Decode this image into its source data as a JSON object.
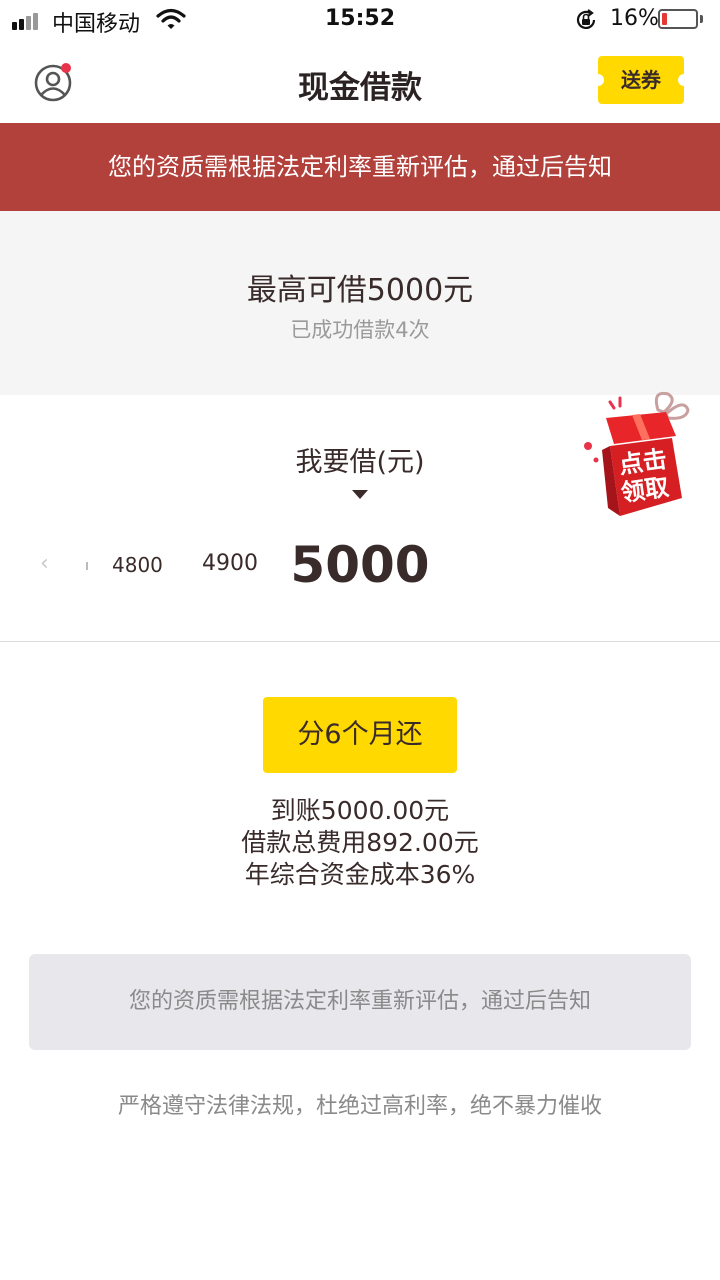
{
  "status_bar": {
    "carrier": "中国移动",
    "time": "15:52",
    "battery_percent": "16%",
    "battery_level": 0.16,
    "battery_color": "#e53935"
  },
  "nav": {
    "title": "现金借款",
    "coupon_label": "送券",
    "coupon_color": "#ffd900",
    "user_icon": "user-profile-icon",
    "notification_dot_color": "#e8334a"
  },
  "red_banner": {
    "text": "您的资质需根据法定利率重新评估，通过后告知",
    "color": "#b2403b"
  },
  "credit": {
    "max_label": "最高可借5000元",
    "borrow_count": "已成功借款4次"
  },
  "borrow": {
    "label": "我要借(元)",
    "amounts": [
      "4800",
      "4900",
      "5000"
    ],
    "selected": "5000"
  },
  "gift_badge": {
    "text_line1": "点击",
    "text_line2": "领取",
    "icon": "gift-box-icon"
  },
  "repay": {
    "button_label": "分6个月还",
    "accent": "#ffd900",
    "details": [
      "到账5000.00元",
      "借款总费用892.00元",
      "年综合资金成本36%"
    ]
  },
  "notice_box": {
    "text": "您的资质需根据法定利率重新评估，通过后告知"
  },
  "footer": {
    "text": "严格遵守法律法规，杜绝过高利率，绝不暴力催收"
  }
}
